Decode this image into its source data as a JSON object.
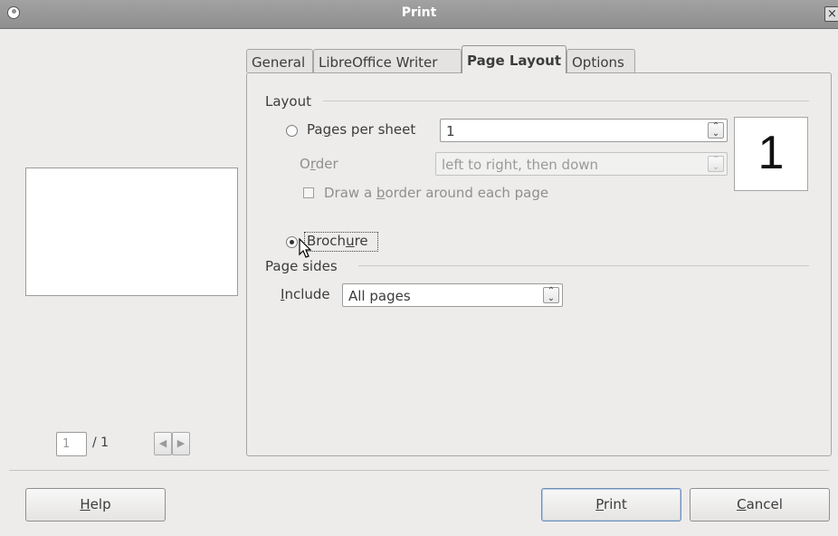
{
  "window": {
    "title": "Print",
    "close_glyph": "×"
  },
  "preview": {
    "current_page": "1",
    "total_label": "/ 1",
    "prev_glyph": "◀",
    "next_glyph": "▶"
  },
  "tabs": [
    {
      "label": "General"
    },
    {
      "label": "LibreOffice Writer"
    },
    {
      "label": "Page Layout"
    },
    {
      "label": "Options"
    }
  ],
  "layout": {
    "group_label": "Layout",
    "pages_per_sheet": {
      "label_pre": "Pa",
      "label_mnemonic": "g",
      "label_post": "es per sheet",
      "value": "1"
    },
    "order": {
      "label_pre": "O",
      "label_mnemonic": "r",
      "label_post": "der",
      "value": "left to right, then down"
    },
    "border": {
      "label_pre": "Draw a ",
      "label_mnemonic": "b",
      "label_post": "order around each page"
    },
    "brochure": {
      "label_pre": "Broch",
      "label_mnemonic": "u",
      "label_post": "re"
    },
    "preview_number": "1"
  },
  "page_sides": {
    "group_label": "Page sides",
    "include": {
      "label_mnemonic": "I",
      "label_post": "nclude",
      "value": "All pages"
    }
  },
  "buttons": {
    "help": {
      "mnemonic": "H",
      "rest": "elp"
    },
    "print": {
      "mnemonic": "P",
      "rest": "rint"
    },
    "cancel": {
      "mnemonic": "C",
      "rest": "ancel"
    }
  },
  "icons": {
    "combo_arrow": "up-down-chevron-icon",
    "cursor": "mouse-pointer-icon"
  }
}
